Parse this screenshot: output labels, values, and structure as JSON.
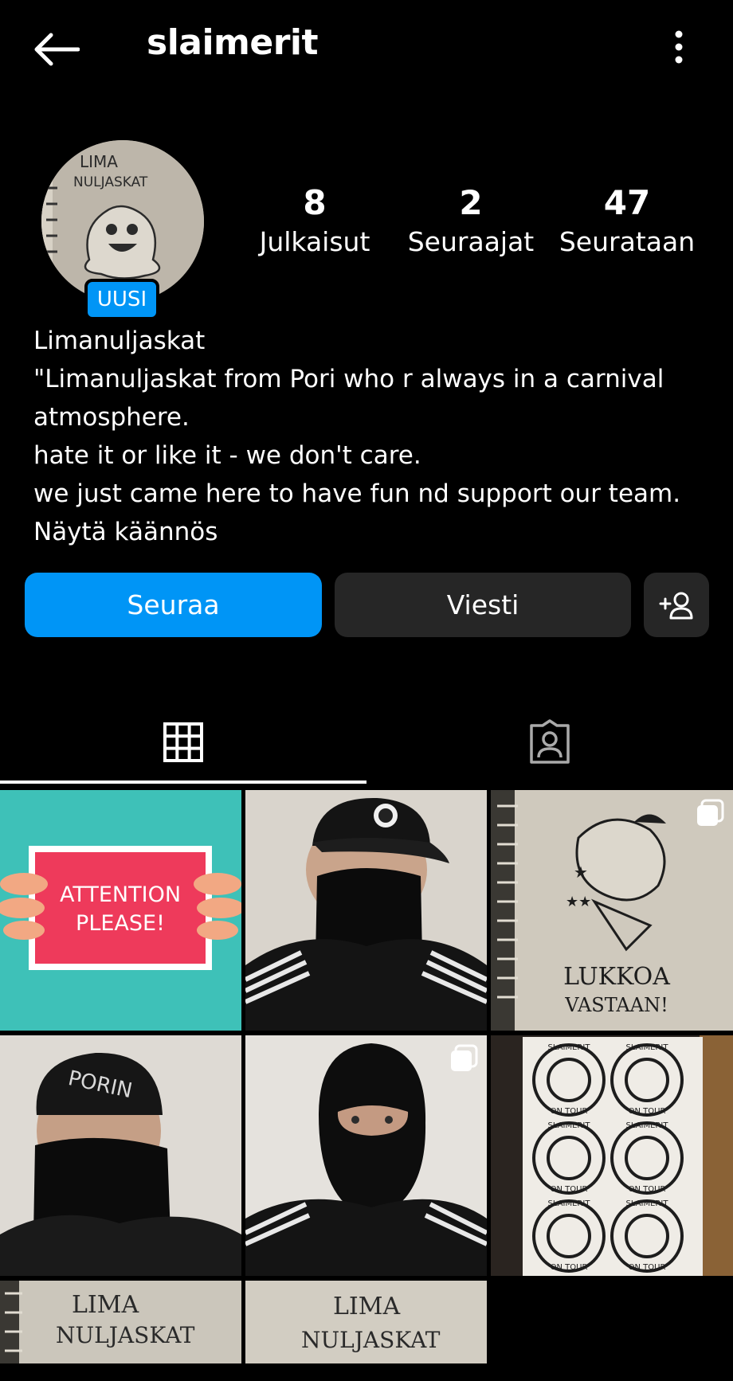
{
  "header": {
    "username": "slaimerit"
  },
  "profile": {
    "new_badge": "UUSI",
    "stats": [
      {
        "value": "8",
        "label": "Julkaisut"
      },
      {
        "value": "2",
        "label": "Seuraajat"
      },
      {
        "value": "47",
        "label": "Seurataan"
      }
    ],
    "bio_lines": [
      "Limanuljaskat",
      "\"Limanuljaskat from Pori who r always in a carnival",
      "atmosphere.",
      "hate it or like it - we don't care.",
      "we just came here to have fun nd support our team."
    ],
    "translate_link": "Näytä käännös"
  },
  "actions": {
    "follow_label": "Seuraa",
    "message_label": "Viesti",
    "suggest_icon": "add-person-icon"
  },
  "tabs": [
    {
      "icon": "grid-icon",
      "active": true
    },
    {
      "icon": "tagged-icon",
      "active": false
    }
  ],
  "posts": [
    {
      "kind": "attention",
      "text_line1": "ATTENTION",
      "text_line2": "PLEASE!",
      "bg": "#3ec1b8",
      "card": "#ee3a5b"
    },
    {
      "kind": "masked-cap",
      "multi": false
    },
    {
      "kind": "drawing-lukkoa",
      "text_line1": "LUKKOA",
      "text_line2": "VASTAAN!",
      "multi": true
    },
    {
      "kind": "masked-beanie",
      "beanie_text": "PORIN",
      "multi": false
    },
    {
      "kind": "balaclava",
      "multi": true
    },
    {
      "kind": "stickers",
      "sticker_text": "SLAIMERIT",
      "sticker_sub": "ON TOUR",
      "multi": false
    },
    {
      "kind": "drawing-lima",
      "text_line1": "LIMA",
      "text_line2": "NULJASKAT"
    },
    {
      "kind": "drawing-lima",
      "text_line1": "LIMA",
      "text_line2": "NULJASKAT"
    }
  ],
  "avatar": {
    "text_line1": "LIMA",
    "text_line2": "NULJASKAT"
  },
  "colors": {
    "accent": "#0095f6",
    "button_dark": "#262626",
    "background": "#000000"
  }
}
